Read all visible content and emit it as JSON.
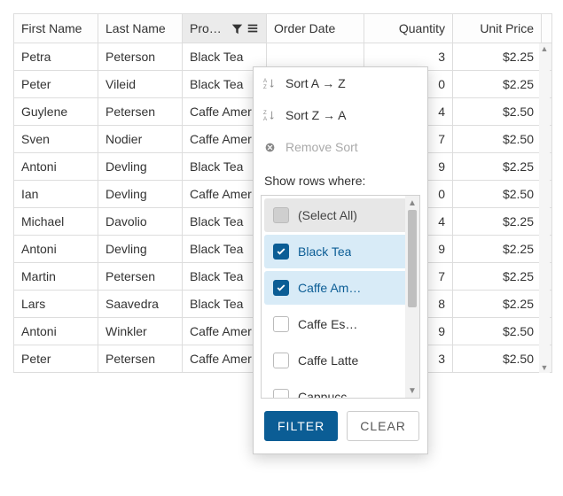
{
  "columns": {
    "first_name": "First Name",
    "last_name": "Last Name",
    "product": "Pro…",
    "order_date": "Order Date",
    "quantity": "Quantity",
    "unit_price": "Unit Price"
  },
  "rows": [
    {
      "first": "Petra",
      "last": "Peterson",
      "product": "Black Tea",
      "qty": "3",
      "price": "$2.25"
    },
    {
      "first": "Peter",
      "last": "Vileid",
      "product": "Black Tea",
      "qty": "0",
      "price": "$2.25"
    },
    {
      "first": "Guylene",
      "last": "Petersen",
      "product": "Caffe Amer",
      "qty": "4",
      "price": "$2.50"
    },
    {
      "first": "Sven",
      "last": "Nodier",
      "product": "Caffe Amer",
      "qty": "7",
      "price": "$2.50"
    },
    {
      "first": "Antoni",
      "last": "Devling",
      "product": "Black Tea",
      "qty": "9",
      "price": "$2.25"
    },
    {
      "first": "Ian",
      "last": "Devling",
      "product": "Caffe Amer",
      "qty": "0",
      "price": "$2.50"
    },
    {
      "first": "Michael",
      "last": "Davolio",
      "product": "Black Tea",
      "qty": "4",
      "price": "$2.25"
    },
    {
      "first": "Antoni",
      "last": "Devling",
      "product": "Black Tea",
      "qty": "9",
      "price": "$2.25"
    },
    {
      "first": "Martin",
      "last": "Petersen",
      "product": "Black Tea",
      "qty": "7",
      "price": "$2.25"
    },
    {
      "first": "Lars",
      "last": "Saavedra",
      "product": "Black Tea",
      "qty": "8",
      "price": "$2.25"
    },
    {
      "first": "Antoni",
      "last": "Winkler",
      "product": "Caffe Amer",
      "qty": "9",
      "price": "$2.50"
    },
    {
      "first": "Peter",
      "last": "Petersen",
      "product": "Caffe Amer",
      "qty": "3",
      "price": "$2.50"
    }
  ],
  "popup": {
    "sort_asc": "Sort A → Z",
    "sort_desc": "Sort Z → A",
    "remove_sort": "Remove Sort",
    "show_rows_where": "Show rows where:",
    "filter_options": {
      "select_all": "(Select All)",
      "black_tea": "Black Tea",
      "caffe_am": "Caffe Am…",
      "caffe_es": "Caffe Es…",
      "caffe_latte": "Caffe Latte",
      "cappucc": "Cappucc…"
    },
    "filter_button": "FILTER",
    "clear_button": "CLEAR"
  }
}
